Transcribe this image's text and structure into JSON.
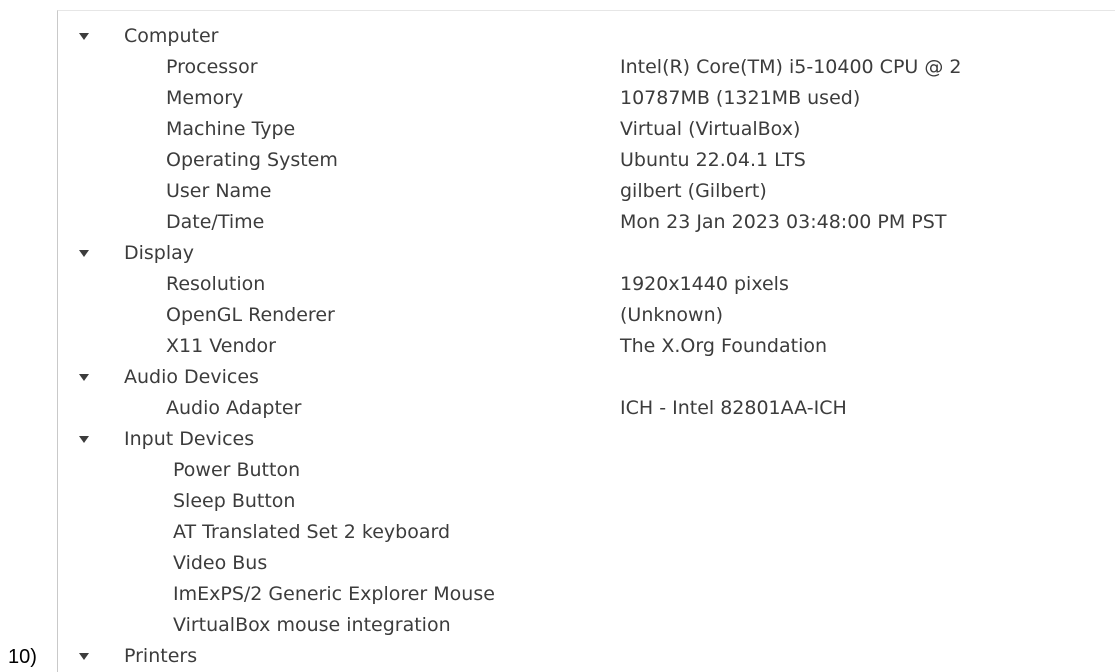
{
  "doc_label": "10)",
  "tree": {
    "computer": {
      "label": "Computer",
      "items": [
        {
          "label": "Processor",
          "value": "Intel(R) Core(TM) i5-10400 CPU @ 2"
        },
        {
          "label": "Memory",
          "value": "10787MB (1321MB used)"
        },
        {
          "label": "Machine Type",
          "value": "Virtual (VirtualBox)"
        },
        {
          "label": "Operating System",
          "value": "Ubuntu 22.04.1 LTS"
        },
        {
          "label": "User Name",
          "value": "gilbert (Gilbert)"
        },
        {
          "label": "Date/Time",
          "value": "Mon 23 Jan 2023 03:48:00 PM PST"
        }
      ]
    },
    "display": {
      "label": "Display",
      "items": [
        {
          "label": "Resolution",
          "value": "1920x1440 pixels"
        },
        {
          "label": "OpenGL Renderer",
          "value": "(Unknown)"
        },
        {
          "label": "X11 Vendor",
          "value": "The X.Org Foundation"
        }
      ]
    },
    "audio": {
      "label": "Audio Devices",
      "items": [
        {
          "label": "Audio Adapter",
          "value": "ICH - Intel 82801AA-ICH"
        }
      ]
    },
    "input": {
      "label": "Input Devices",
      "items": [
        {
          "label": "Power Button"
        },
        {
          "label": "Sleep Button"
        },
        {
          "label": "AT Translated Set 2 keyboard"
        },
        {
          "label": "Video Bus"
        },
        {
          "label": "ImExPS/2 Generic Explorer Mouse"
        },
        {
          "label": "VirtualBox mouse integration"
        }
      ]
    },
    "printers": {
      "label": "Printers",
      "items": []
    }
  }
}
